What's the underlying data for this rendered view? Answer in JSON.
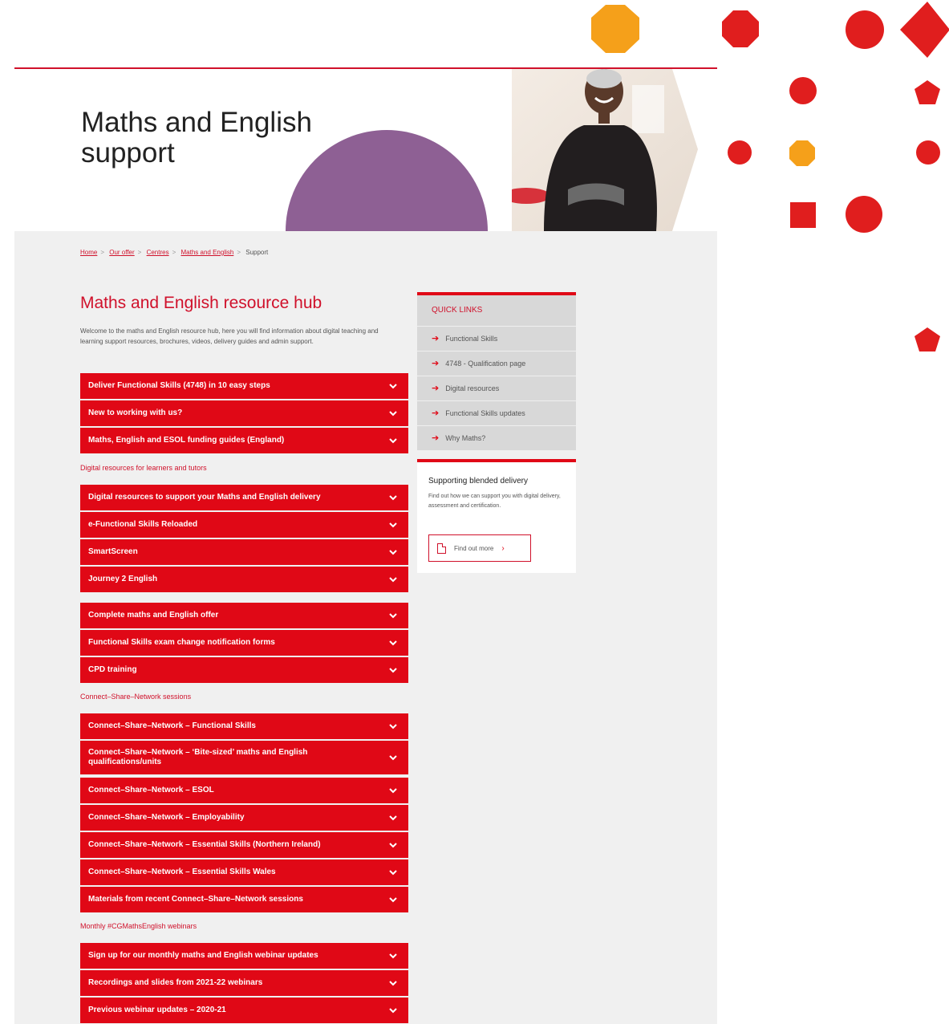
{
  "page": {
    "title": "Maths and English support"
  },
  "breadcrumb": [
    "Home",
    "Our offer",
    "Centres",
    "Maths and English",
    "Support"
  ],
  "main": {
    "heading": "Maths and English resource hub",
    "intro": "Welcome to the maths and English resource hub, here you will find information about digital teaching and learning support resources, brochures, videos, delivery guides and admin support."
  },
  "sections": {
    "digital": "Digital resources for learners and tutors",
    "csn": "Connect–Share–Network sessions",
    "webinars": "Monthly #CGMathsEnglish webinars"
  },
  "accordions": {
    "group1": [
      "Deliver Functional Skills (4748) in 10 easy steps",
      "New to working with us?",
      "Maths, English and ESOL funding guides (England)"
    ],
    "group2": [
      "Digital resources to support your Maths and English delivery",
      "e-Functional Skills Reloaded",
      "SmartScreen",
      "Journey 2 English"
    ],
    "group3": [
      "Complete maths and English offer",
      "Functional Skills exam change notification forms",
      "CPD training"
    ],
    "group4": [
      "Connect–Share–Network – Functional Skills",
      "Connect–Share–Network – ‘Bite-sized’ maths and English qualifications/units",
      "Connect–Share–Network – ESOL",
      "Connect–Share–Network – Employability",
      "Connect–Share–Network – Essential Skills (Northern Ireland)",
      "Connect–Share–Network – Essential Skills Wales",
      "Materials from recent Connect–Share–Network sessions"
    ],
    "group5": [
      "Sign up for our monthly maths and English webinar updates",
      "Recordings and slides from 2021-22 webinars",
      "Previous webinar updates – 2020-21"
    ]
  },
  "quick_links": {
    "title": "QUICK LINKS",
    "items": [
      "Functional Skills",
      "4748 - Qualification page",
      "Digital resources",
      "Functional Skills updates",
      "Why Maths?"
    ]
  },
  "blended": {
    "title": "Supporting blended delivery",
    "text": "Find out how we can support you with digital delivery, assessment and certification.",
    "button": "Find out more"
  },
  "colors": {
    "accent": "#e00816",
    "brand_red": "#d0112b",
    "orange": "#f5a01a",
    "magenta": "#c4308a",
    "purple": "#8e6094"
  }
}
